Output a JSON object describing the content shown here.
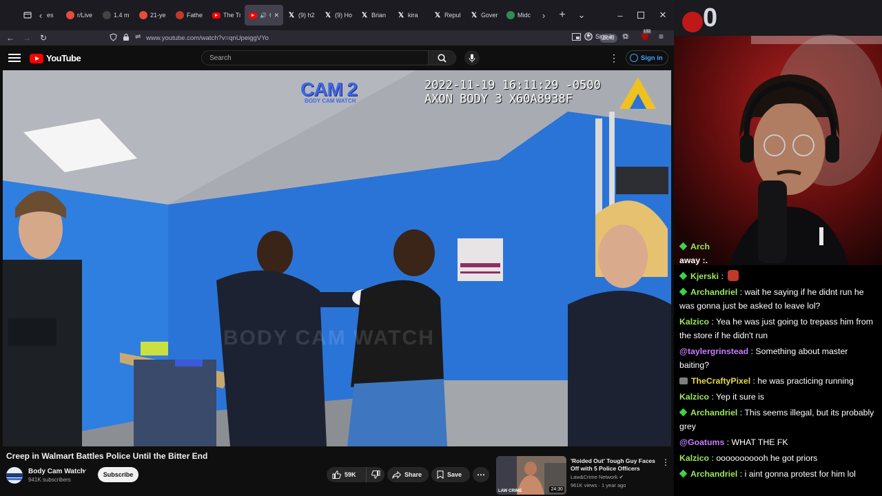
{
  "browser": {
    "tabs": [
      {
        "label": "r/Live",
        "fav": "shield",
        "color": "#e74c3c"
      },
      {
        "label": "1.4 m",
        "fav": "pbs",
        "color": "#444444"
      },
      {
        "label": "21-ye",
        "fav": "shield",
        "color": "#e74c3c"
      },
      {
        "label": "Fathe",
        "fav": "news",
        "color": "#c0392b"
      },
      {
        "label": "The Tr",
        "fav": "youtube",
        "color": "#ff0000"
      },
      {
        "label": "Cre",
        "fav": "youtube",
        "color": "#ff0000",
        "active": true
      },
      {
        "label": "(9) h2",
        "fav": "x",
        "color": "#000000"
      },
      {
        "label": "(9) Ho",
        "fav": "x",
        "color": "#000000"
      },
      {
        "label": "Brian",
        "fav": "x",
        "color": "#000000"
      },
      {
        "label": "kira",
        "fav": "x",
        "color": "#000000"
      },
      {
        "label": "Repul",
        "fav": "x",
        "color": "#000000"
      },
      {
        "label": "Gover",
        "fav": "x",
        "color": "#000000"
      },
      {
        "label": "Midc",
        "fav": "globe",
        "color": "#2e8b57"
      }
    ],
    "tab_fragment": "es",
    "url": "www.youtube.com/watch?v=qnUpeiggVYo",
    "zoom": "90%",
    "sign_in": "Sign in",
    "ext_badge": "132"
  },
  "youtube": {
    "logo": "YouTube",
    "search_placeholder": "Search",
    "sign_in": "Sign in"
  },
  "video": {
    "cam_label": "CAM 2",
    "cam_sublabel": "BODY CAM WATCH",
    "timestamp": "2022-11-19 16:11:29 -0500\nAXON BODY 3 X60A8938F",
    "watermark": "BODY CAM WATCH",
    "title": "Creep in Walmart Battles Police Until the Bitter End",
    "channel": "Body Cam Watch",
    "subscribers": "941K subscribers",
    "subscribe_label": "Subscribe",
    "likes": "59K",
    "share_label": "Share",
    "save_label": "Save"
  },
  "related": {
    "title": "'Roided Out' Tough Guy Faces Off with 5 Police Officers",
    "channel": "Law&Crime Network",
    "meta": "961K views · 1 year ago",
    "duration": "24:30",
    "badge": "LAW CRIME"
  },
  "stream": {
    "counter": "0"
  },
  "chat": [
    {
      "badge": "diamond",
      "user": "Arch",
      "color": "#9ee85c",
      "text": "",
      "continued": "away :."
    },
    {
      "badge": "diamond",
      "user": "Kjerski",
      "color": "#9ee85c",
      "text": "",
      "emote": true
    },
    {
      "badge": "diamond",
      "user": "Archandriel",
      "color": "#9ee85c",
      "text": "wait he saying if he didnt run he was gonna just be asked to leave lol?"
    },
    {
      "badge": "",
      "user": "Kalzico",
      "color": "#9ee85c",
      "text": "Yea he was just going to trepass him from the store if he didn't run"
    },
    {
      "badge": "",
      "user": "@taylergrinstead",
      "color": "#c77dff",
      "text": "Something about master baiting?"
    },
    {
      "badge": "gift",
      "user": "TheCraftyPixel",
      "color": "#e6d94a",
      "text": "he was practicing running"
    },
    {
      "badge": "",
      "user": "Kalzico",
      "color": "#9ee85c",
      "text": "Yep it sure is"
    },
    {
      "badge": "diamond",
      "user": "Archandriel",
      "color": "#9ee85c",
      "text": "This seems illegal, but its probably grey"
    },
    {
      "badge": "",
      "user": "@Goatums",
      "color": "#c77dff",
      "text": "WHAT THE FK"
    },
    {
      "badge": "",
      "user": "Kalzico",
      "color": "#9ee85c",
      "text": "ooooooooooh he got priors"
    },
    {
      "badge": "diamond",
      "user": "Archandriel",
      "color": "#9ee85c",
      "text": "i aint gonna protest for him lol"
    }
  ]
}
